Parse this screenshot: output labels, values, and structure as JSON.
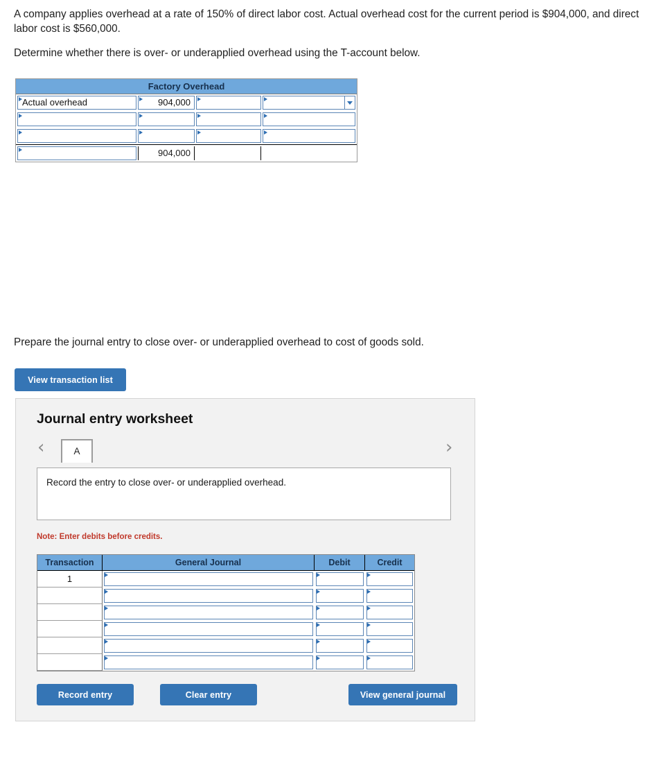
{
  "question": {
    "paragraph_1": "A company applies overhead at a rate of 150% of direct labor cost. Actual overhead cost for the current period is $904,000, and direct labor cost is $560,000.",
    "paragraph_2": "Determine whether there is over- or underapplied overhead using the T-account below.",
    "paragraph_3": "Prepare the journal entry to close over- or underapplied overhead to cost of goods sold."
  },
  "t_account": {
    "title": "Factory Overhead",
    "rows": [
      {
        "left_label": "Actual overhead",
        "debit": "904,000",
        "right_label": "",
        "credit": "",
        "has_dropdown": true
      },
      {
        "left_label": "",
        "debit": "",
        "right_label": "",
        "credit": "",
        "has_dropdown": false
      },
      {
        "left_label": "",
        "debit": "",
        "right_label": "",
        "credit": "",
        "has_dropdown": false
      }
    ],
    "total_row": {
      "left_label": "",
      "debit": "904,000",
      "right_label": "",
      "credit": ""
    }
  },
  "toolbar": {
    "view_transaction_list": "View transaction list"
  },
  "worksheet": {
    "title": "Journal entry worksheet",
    "prev_icon": "‹",
    "next_icon": "›",
    "tabs": [
      {
        "label": "A",
        "active": true
      }
    ],
    "instruction": "Record the entry to close over- or underapplied overhead.",
    "note": "Note: Enter debits before credits.",
    "table": {
      "headers": [
        "Transaction",
        "General Journal",
        "Debit",
        "Credit"
      ],
      "rows": [
        {
          "transaction": "1",
          "general_journal": "",
          "debit": "",
          "credit": ""
        },
        {
          "transaction": "",
          "general_journal": "",
          "debit": "",
          "credit": ""
        },
        {
          "transaction": "",
          "general_journal": "",
          "debit": "",
          "credit": ""
        },
        {
          "transaction": "",
          "general_journal": "",
          "debit": "",
          "credit": ""
        },
        {
          "transaction": "",
          "general_journal": "",
          "debit": "",
          "credit": ""
        },
        {
          "transaction": "",
          "general_journal": "",
          "debit": "",
          "credit": ""
        }
      ]
    },
    "buttons": {
      "record_entry": "Record entry",
      "clear_entry": "Clear entry",
      "view_general_journal": "View general journal"
    }
  },
  "colors": {
    "header_blue": "#6fa8dc",
    "button_blue": "#3575b5",
    "input_border_blue": "#5a85b5",
    "marker_blue": "#2f6fb3",
    "note_red": "#c0392b",
    "panel_grey": "#f2f2f2"
  }
}
